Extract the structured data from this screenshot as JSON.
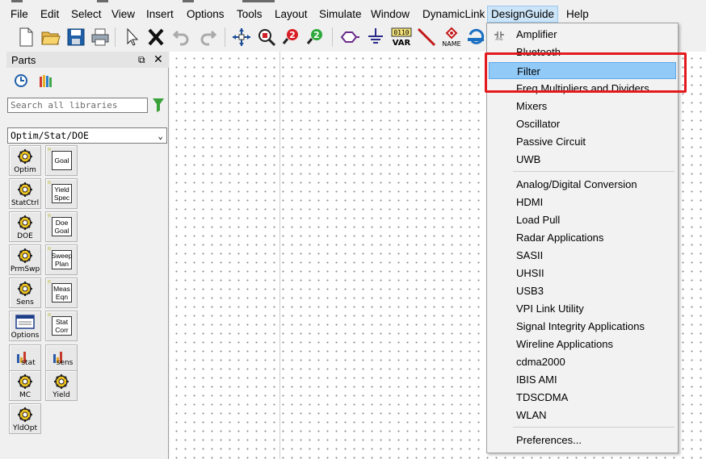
{
  "menubar": {
    "items": [
      "File",
      "Edit",
      "Select",
      "View",
      "Insert",
      "Options",
      "Tools",
      "Layout",
      "Simulate",
      "Window",
      "DynamicLink",
      "DesignGuide",
      "Help"
    ],
    "active": "DesignGuide"
  },
  "toolbar": {
    "var_top": "0110",
    "var_bottom": "VAR",
    "name_label": "NAME"
  },
  "parts_panel": {
    "title": "Parts",
    "float_glyph": "⧉",
    "close_glyph": "✕",
    "search_placeholder": "Search all libraries",
    "library_selected": "Optim/Stat/DOE",
    "chevron": "⌄",
    "palette": [
      {
        "label": "Optim",
        "kind": "gear"
      },
      {
        "label": "Goal",
        "kind": "box"
      },
      {
        "label": "StatCtrl",
        "kind": "gear"
      },
      {
        "label": "Yield Spec",
        "kind": "box"
      },
      {
        "label": "DOE",
        "kind": "gear"
      },
      {
        "label": "Doe Goal",
        "kind": "box"
      },
      {
        "label": "PrmSwp",
        "kind": "gear"
      },
      {
        "label": "Sweep Plan",
        "kind": "box"
      },
      {
        "label": "Sens",
        "kind": "gear"
      },
      {
        "label": "Meas Eqn",
        "kind": "box"
      },
      {
        "label": "Options",
        "kind": "window"
      },
      {
        "label": "Stat Corr",
        "kind": "box"
      },
      {
        "label": "stat",
        "kind": "bars"
      },
      {
        "label": "sens",
        "kind": "bars"
      },
      {
        "label": "MC",
        "kind": "gear"
      },
      {
        "label": "Yield",
        "kind": "gear"
      },
      {
        "label": "YldOpt",
        "kind": "gear"
      }
    ]
  },
  "designguide_menu": {
    "icon": "filter-guide-icon",
    "items": [
      "Amplifier",
      "Bluetooth",
      "Filter",
      "Freq Multipliers and Dividers",
      "Mixers",
      "Oscillator",
      "Passive Circuit",
      "UWB",
      "Analog/Digital Conversion",
      "HDMI",
      "Load Pull",
      "Radar Applications",
      "SASII",
      "UHSII",
      "USB3",
      "VPI Link Utility",
      "Signal Integrity Applications",
      "Wireline Applications",
      "cdma2000",
      "IBIS AMI",
      "TDSCDMA",
      "WLAN",
      "Preferences..."
    ],
    "highlighted": "Filter"
  },
  "colors": {
    "highlight_box": "#e3191c",
    "menu_highlight": "#91c9f7"
  }
}
